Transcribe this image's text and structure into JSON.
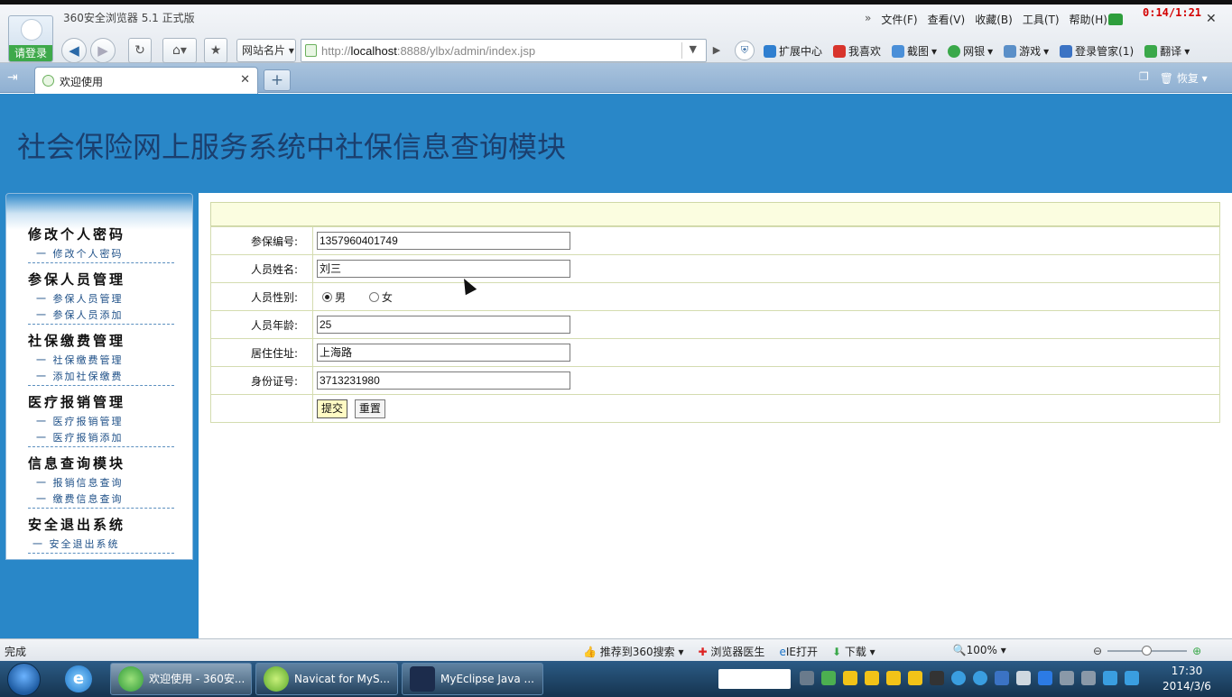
{
  "browser": {
    "app_title": "360安全浏览器 5.1 正式版",
    "login_label": "请登录",
    "menu": [
      "文件(F)",
      "查看(V)",
      "收藏(B)",
      "工具(T)",
      "帮助(H)"
    ],
    "timer": "0:14/1:21",
    "favorites_label": "网站名片",
    "url_prefix": "http://",
    "url_host": "localhost",
    "url_rest": ":8888/ylbx/admin/index.jsp",
    "toolbar": [
      "扩展中心",
      "我喜欢",
      "截图",
      "网银",
      "游戏",
      "登录管家(1)",
      "翻译"
    ],
    "tab_title": "欢迎使用",
    "restore_label": "恢复"
  },
  "page": {
    "title": "社会保险网上服务系统中社保信息查询模块"
  },
  "sidebar": {
    "sections": [
      {
        "title": "修改个人密码",
        "items": [
          "一 修改个人密码"
        ]
      },
      {
        "title": "参保人员管理",
        "items": [
          "一 参保人员管理",
          "一 参保人员添加"
        ]
      },
      {
        "title": "社保缴费管理",
        "items": [
          "一 社保缴费管理",
          "一 添加社保缴费"
        ]
      },
      {
        "title": "医疗报销管理",
        "items": [
          "一 医疗报销管理",
          "一 医疗报销添加"
        ]
      },
      {
        "title": "信息查询模块",
        "items": [
          "一 报销信息查询",
          "一 缴费信息查询"
        ]
      },
      {
        "title": "安全退出系统",
        "items": [
          "一 安全退出系统"
        ]
      }
    ]
  },
  "form": {
    "id_label": "参保编号:",
    "id_value": "1357960401749",
    "name_label": "人员姓名:",
    "name_value": "刘三",
    "gender_label": "人员性别:",
    "gender_male": "男",
    "gender_female": "女",
    "age_label": "人员年龄:",
    "age_value": "25",
    "address_label": "居住住址:",
    "address_value": "上海路",
    "idcard_label": "身份证号:",
    "idcard_value": "3713231980",
    "submit_label": "提交",
    "reset_label": "重置"
  },
  "statusbar": {
    "status": "完成",
    "items": [
      "推荐到360搜索",
      "浏览器医生",
      "IE打开",
      "下载"
    ],
    "zoom": "100%"
  },
  "taskbar": {
    "tasks": [
      "欢迎使用 - 360安...",
      "Navicat for MyS...",
      "MyEclipse Java ..."
    ],
    "time": "17:30",
    "date": "2014/3/6"
  }
}
